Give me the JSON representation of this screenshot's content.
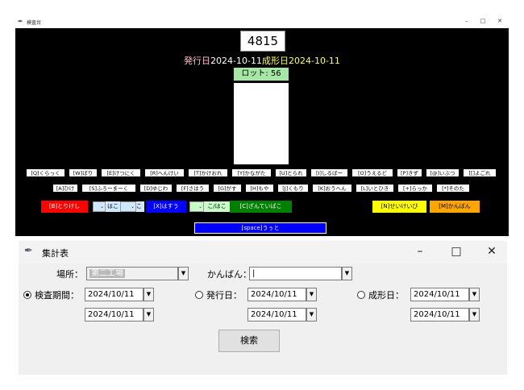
{
  "win1": {
    "title": "検査台",
    "counter": "4815",
    "issue_label": "発行日",
    "issue_date": "2024-10-11",
    "form_label": "成形日",
    "form_date": "2024-10-11",
    "lot": "ロット: 56",
    "keys_row1": [
      "[Q]くらっく",
      "[W]ばり",
      "[E]けつにく",
      "[R]へんけい",
      "[T]かけおれ",
      "[Y]かながた",
      "[U]とられ",
      "[I]しるばー",
      "[O]うえるど",
      "[P]きず",
      "[@]いぶつ",
      "[[]よごれ"
    ],
    "keys_row2": [
      "[A]ひけ",
      "[S]ふろーまーく",
      "[D]ゆじわ",
      "[F]さはう",
      "[G]がす",
      "[H]もや",
      "[J]くもり",
      "[K]おうへん",
      "[L]いとひき",
      "[+]らっか",
      "[*]そのた"
    ],
    "btn_b": "[B]とりけし",
    "lbl_ha": "はこ",
    "lbl_c": "こ",
    "btn_x": "[X]はすう",
    "lbl_hc": "こ/はこ",
    "btn_cc": "[C]ざんていばこ",
    "btn_n": "[N]せいけいび",
    "btn_m": "[M]かんばん",
    "btn_space": "[space]うぅと"
  },
  "win2": {
    "title": "集計表",
    "place_label": "場所：",
    "place_value": "第二工場",
    "kanban_label": "かんばん：",
    "kanban_value": "|",
    "period_label": "検査期間：",
    "issue_label": "発行日：",
    "form_label": "成形日：",
    "period_from": "2024/10/11",
    "period_to": "2024/10/11",
    "issue_from": "2024/10/11",
    "issue_to": "2024/10/11",
    "form_from": "2024/10/11",
    "form_to": "2024/10/11",
    "search_label": "検索",
    "selected_radio": "period"
  }
}
